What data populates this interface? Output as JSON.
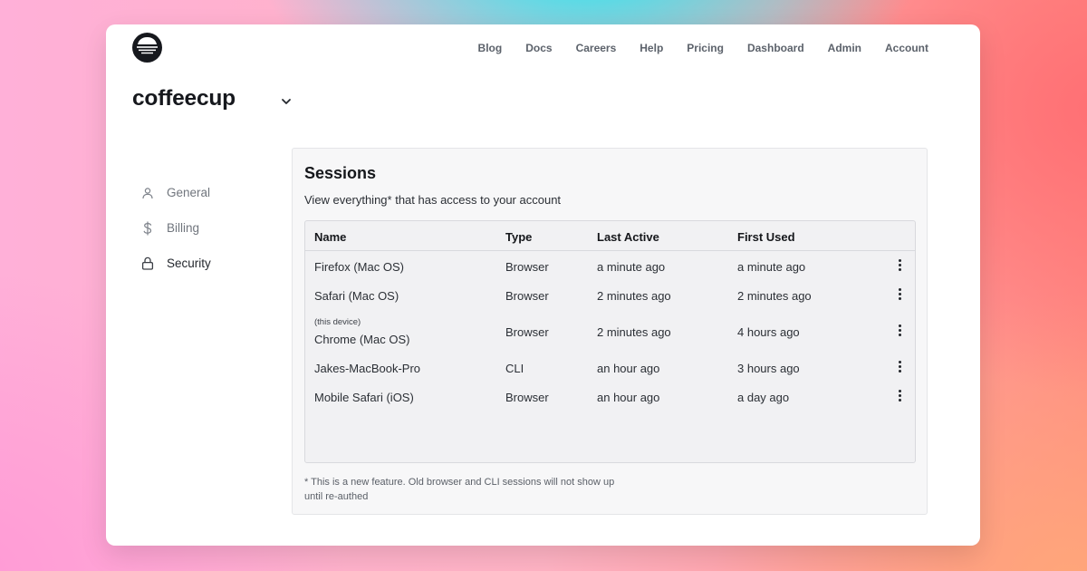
{
  "brand": {
    "logo_icon": "coffeecup-logo-icon"
  },
  "nav": {
    "items": [
      "Blog",
      "Docs",
      "Careers",
      "Help",
      "Pricing",
      "Dashboard",
      "Admin",
      "Account"
    ]
  },
  "org": {
    "name": "coffeecup"
  },
  "sidebar": {
    "items": [
      {
        "label": "General",
        "icon": "user-icon",
        "active": false
      },
      {
        "label": "Billing",
        "icon": "dollar-icon",
        "active": false
      },
      {
        "label": "Security",
        "icon": "lock-icon",
        "active": true
      }
    ]
  },
  "sessions": {
    "title": "Sessions",
    "subtitle": "View everything* that has access to your account",
    "columns": [
      "Name",
      "Type",
      "Last Active",
      "First Used"
    ],
    "rows": [
      {
        "name": "Firefox (Mac OS)",
        "tag": "",
        "type": "Browser",
        "last_active": "a minute ago",
        "first_used": "a minute ago"
      },
      {
        "name": "Safari (Mac OS)",
        "tag": "",
        "type": "Browser",
        "last_active": "2 minutes ago",
        "first_used": "2 minutes ago"
      },
      {
        "name": "Chrome (Mac OS)",
        "tag": "(this device)",
        "type": "Browser",
        "last_active": "2 minutes ago",
        "first_used": "4 hours ago"
      },
      {
        "name": "Jakes-MacBook-Pro",
        "tag": "",
        "type": "CLI",
        "last_active": "an hour ago",
        "first_used": "3 hours ago"
      },
      {
        "name": "Mobile Safari (iOS)",
        "tag": "",
        "type": "Browser",
        "last_active": "an hour ago",
        "first_used": "a day ago"
      }
    ],
    "footnote_line1": "* This is a new feature. Old browser and CLI sessions will not show up",
    "footnote_line2": "until re-authed"
  },
  "colors": {
    "accent_dark": "#16181d",
    "panel_bg": "#f7f7f8",
    "muted_text": "#70757d"
  }
}
